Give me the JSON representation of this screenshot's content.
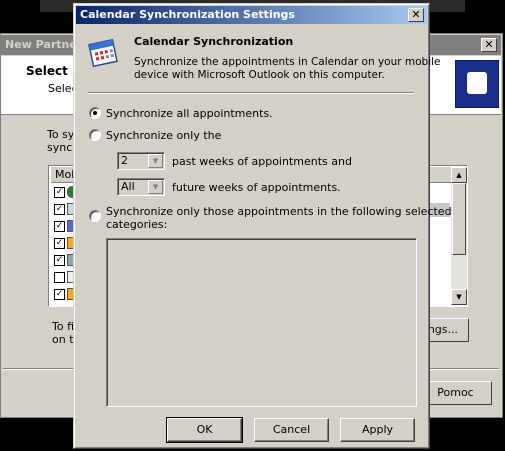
{
  "background_window": {
    "title": "New Partner",
    "close_label": "✕",
    "header_title": "Select S",
    "header_subtitle": "Selec",
    "intro_line1": "To sy",
    "intro_line2": "synch",
    "list_column_header": "Mob",
    "footer_line1": "To fi",
    "footer_line2": "on th",
    "settings_button_label": "ings...",
    "help_button_label": "Pomoc"
  },
  "dialog": {
    "title": "Calendar Synchronization Settings",
    "close_label": "✕",
    "header": {
      "title": "Calendar Synchronization",
      "description_line1": "Synchronize the appointments in Calendar on your mobile",
      "description_line2": "device with Microsoft Outlook on this computer."
    },
    "options": {
      "all_label": "Synchronize all appointments.",
      "only_label": "Synchronize only the",
      "past_value": "2",
      "past_label": "past weeks of appointments and",
      "future_value": "All",
      "future_label": "future weeks of appointments.",
      "categories_label_line1": "Synchronize only those appointments in the following selected",
      "categories_label_line2": "categories:",
      "selected": "all"
    },
    "buttons": {
      "ok": "OK",
      "cancel": "Cancel",
      "apply": "Apply"
    }
  },
  "icons": [
    "calendar-icon",
    "combo-arrow-icon",
    "scroll-up-icon",
    "scroll-down-icon",
    "close-icon"
  ],
  "colors": {
    "titlebar_start": "#0a246a",
    "titlebar_end": "#a6caf0",
    "face": "#d4d0c8",
    "bg_logo": "#1a2f8c"
  }
}
